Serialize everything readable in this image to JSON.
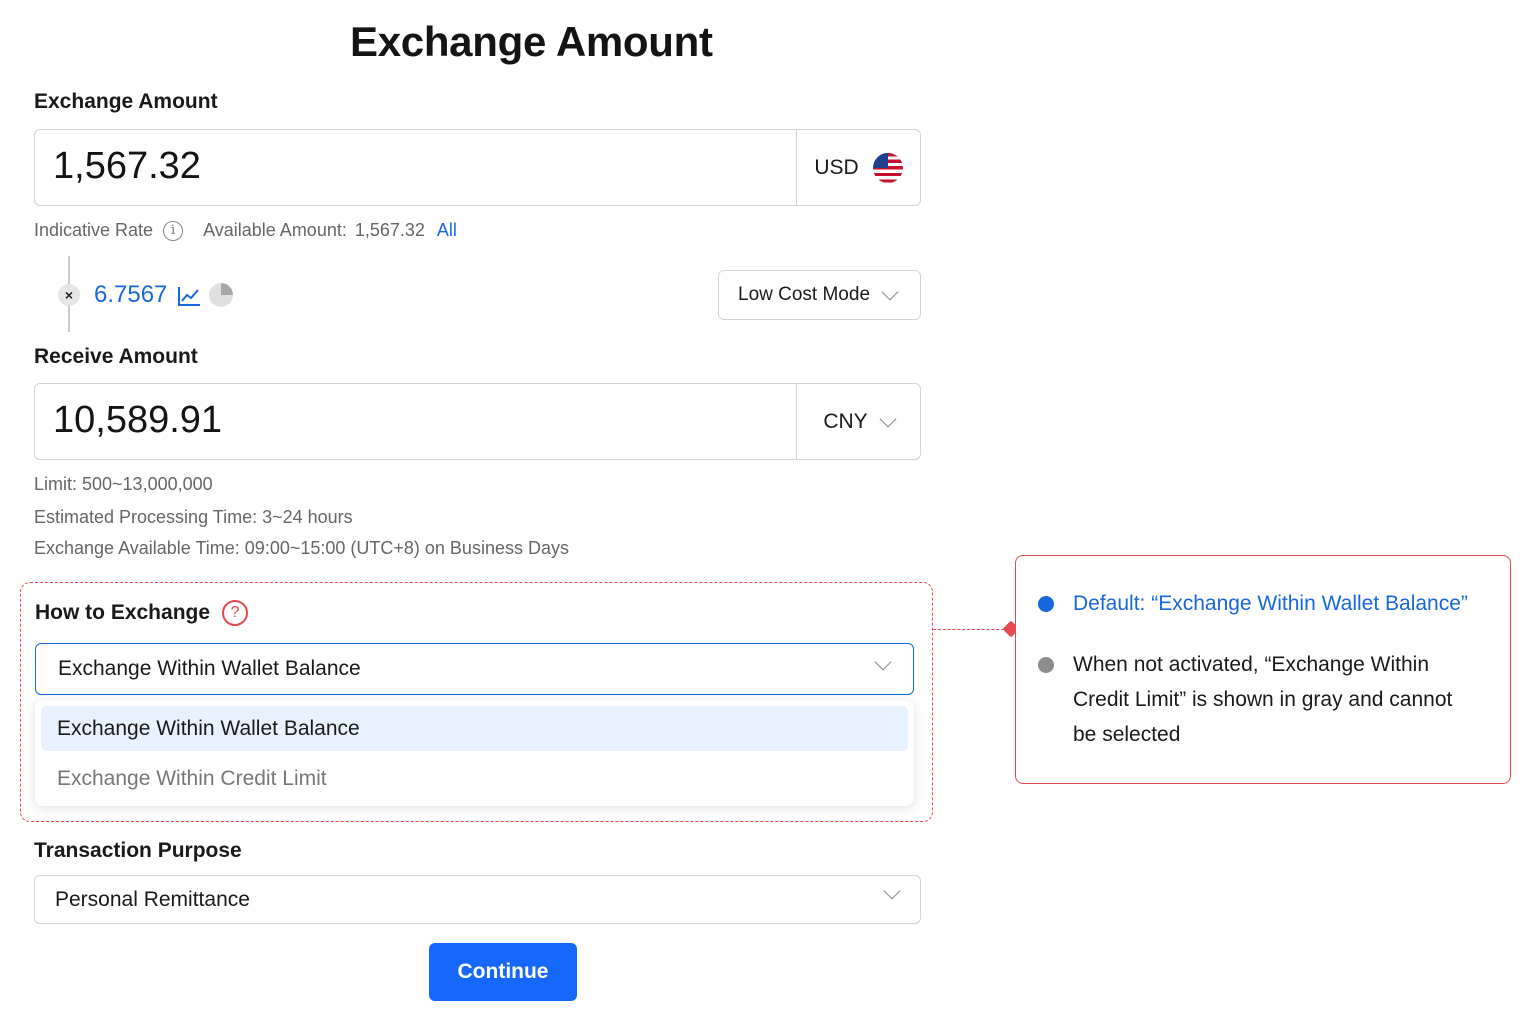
{
  "page": {
    "title": "Exchange Amount"
  },
  "exchange": {
    "label": "Exchange Amount",
    "value": "1,567.32",
    "currency": "USD",
    "currency_flag_icon": "us-flag-icon"
  },
  "rate": {
    "indicative_label": "Indicative Rate",
    "info_glyph": "i",
    "available_label": "Available Amount:",
    "available_value": "1,567.32",
    "all_link": "All",
    "multiply_glyph": "×",
    "value": "6.7567",
    "mode": "Low Cost Mode"
  },
  "receive": {
    "label": "Receive Amount",
    "value": "10,589.91",
    "currency": "CNY"
  },
  "info": {
    "limit": "Limit:  500~13,000,000",
    "processing": "Estimated Processing Time:  3~24 hours",
    "available_time": "Exchange Available Time:  09:00~15:00 (UTC+8) on Business Days"
  },
  "how": {
    "label": "How to Exchange",
    "help_glyph": "?",
    "selected": "Exchange Within Wallet Balance",
    "options": [
      {
        "label": "Exchange Within Wallet Balance",
        "state": "selected"
      },
      {
        "label": "Exchange Within Credit Limit",
        "state": "disabled"
      }
    ]
  },
  "note": {
    "items": [
      "Default:  “Exchange Within Wallet Balance”",
      "When not activated,  “Exchange Within Credit Limit”  is shown in gray and cannot be selected"
    ]
  },
  "purpose": {
    "label": "Transaction Purpose",
    "value": "Personal Remittance"
  },
  "actions": {
    "continue_label": "Continue"
  },
  "colors": {
    "accent": "#1668dc",
    "button": "#1668fd",
    "annotation": "#e5484d",
    "selected_option_bg": "#e8f1fe"
  }
}
